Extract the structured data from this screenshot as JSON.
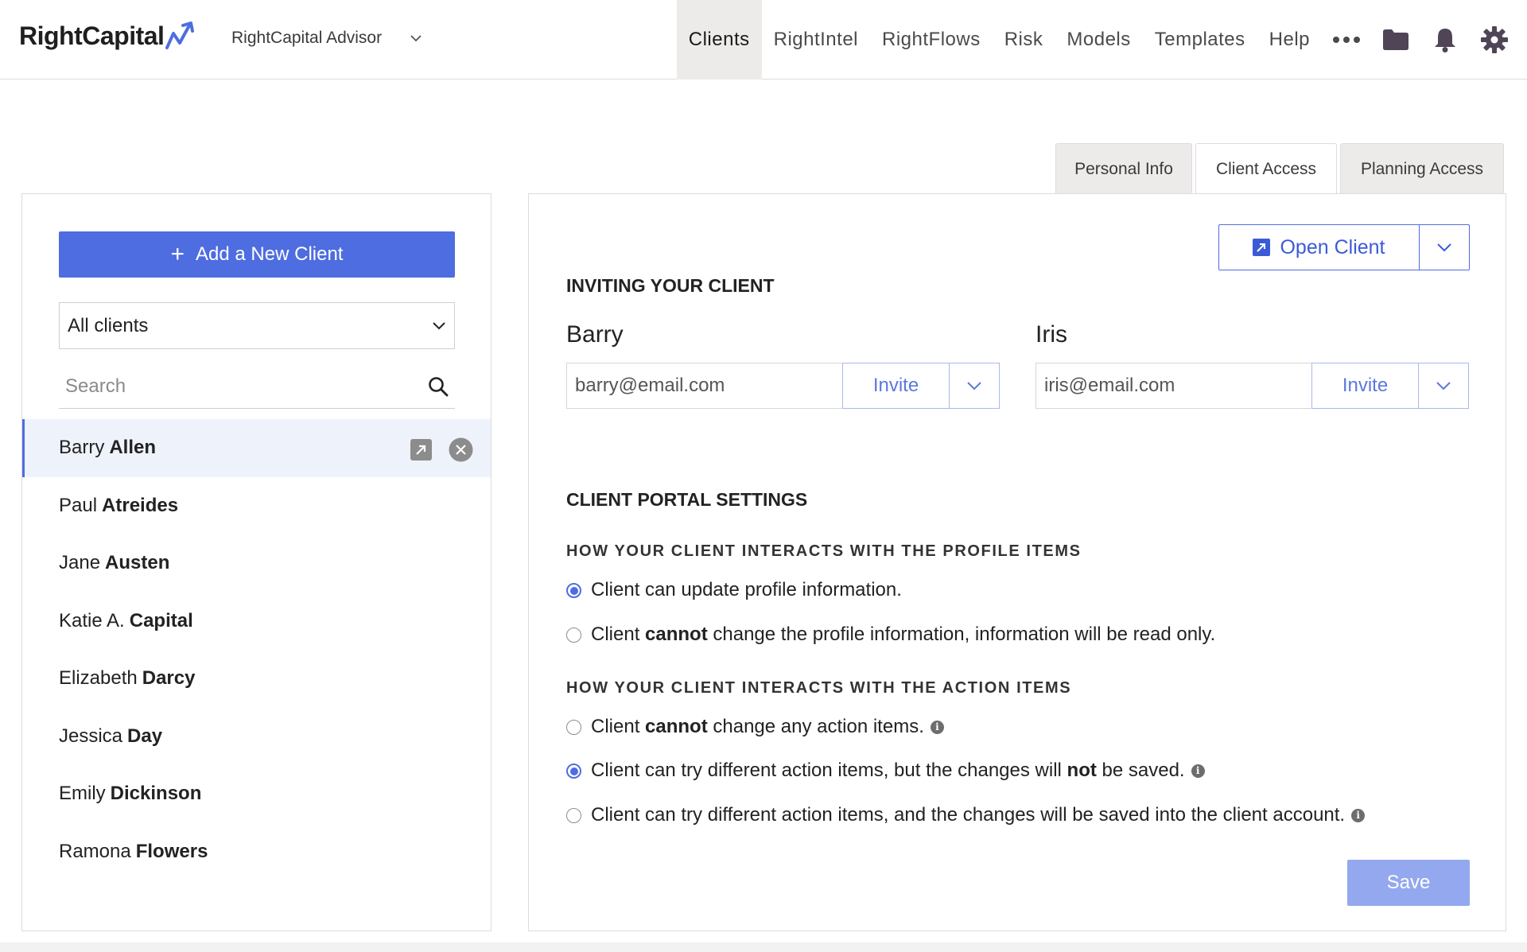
{
  "header": {
    "logo_text": "RightCapital",
    "workspace": "RightCapital Advisor",
    "nav": [
      {
        "label": "Clients",
        "active": true
      },
      {
        "label": "RightIntel"
      },
      {
        "label": "RightFlows"
      },
      {
        "label": "Risk"
      },
      {
        "label": "Models"
      },
      {
        "label": "Templates"
      },
      {
        "label": "Help"
      }
    ],
    "icons": [
      "more-icon",
      "folder-icon",
      "bell-icon",
      "gear-icon"
    ]
  },
  "tabs": [
    {
      "label": "Personal Info"
    },
    {
      "label": "Client Access",
      "active": true
    },
    {
      "label": "Planning Access"
    }
  ],
  "sidebar": {
    "add_button": "Add a New Client",
    "filter_value": "All clients",
    "search_placeholder": "Search",
    "clients": [
      {
        "first": "Barry",
        "last": "Allen",
        "selected": true
      },
      {
        "first": "Paul",
        "last": "Atreides"
      },
      {
        "first": "Jane",
        "last": "Austen"
      },
      {
        "first": "Katie A.",
        "last": "Capital"
      },
      {
        "first": "Elizabeth",
        "last": "Darcy"
      },
      {
        "first": "Jessica",
        "last": "Day"
      },
      {
        "first": "Emily",
        "last": "Dickinson"
      },
      {
        "first": "Ramona",
        "last": "Flowers"
      }
    ]
  },
  "main": {
    "open_client": "Open Client",
    "inviting_heading": "INVITING YOUR CLIENT",
    "invitees": [
      {
        "name": "Barry",
        "email": "barry@email.com",
        "button": "Invite"
      },
      {
        "name": "Iris",
        "email": "iris@email.com",
        "button": "Invite"
      }
    ],
    "portal_heading": "CLIENT PORTAL SETTINGS",
    "profile_heading": "HOW YOUR CLIENT INTERACTS WITH THE PROFILE ITEMS",
    "profile_options": {
      "a": {
        "text": "Client can update profile information."
      },
      "b": {
        "pre": "Client ",
        "bold": "cannot",
        "post": " change the profile information, information will be read only."
      }
    },
    "action_heading": "HOW YOUR CLIENT INTERACTS WITH THE ACTION ITEMS",
    "action_options": {
      "a": {
        "pre": "Client ",
        "bold": "cannot",
        "post": " change any action items."
      },
      "b": {
        "pre": "Client can try different action items, but the changes will ",
        "bold": "not",
        "post": " be saved."
      },
      "c": {
        "text": "Client can try different action items, and the changes will be saved into the client account."
      }
    },
    "save_button": "Save",
    "accent_color": "#4e6de0"
  }
}
